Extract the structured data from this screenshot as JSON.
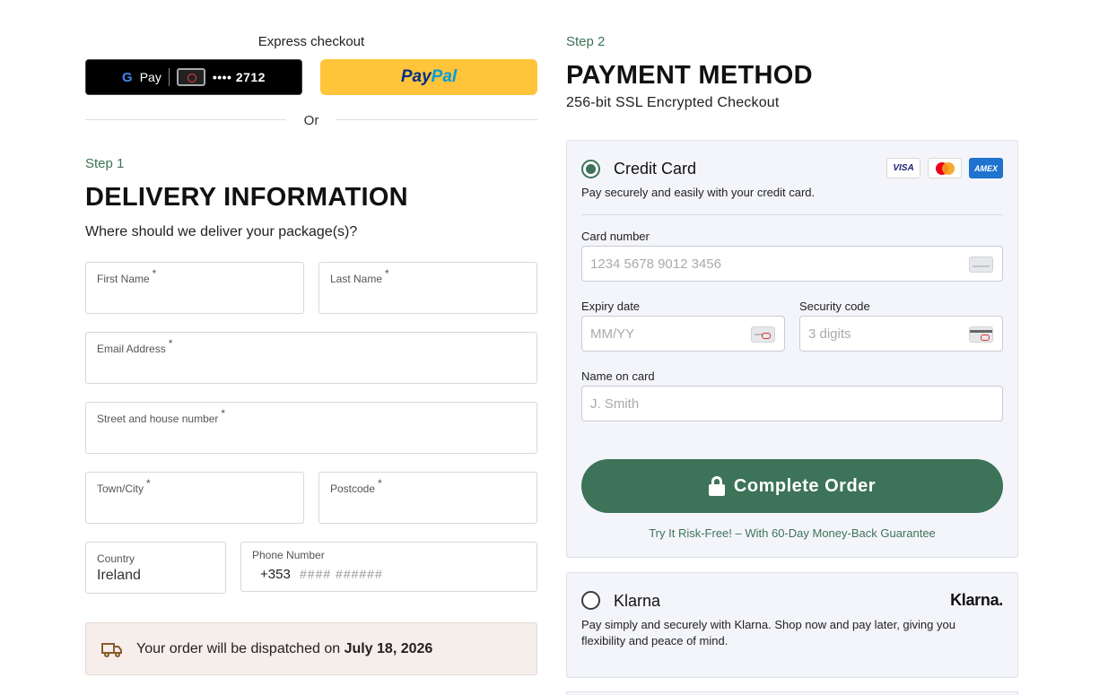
{
  "express": {
    "title": "Express checkout",
    "gpay_label": "Pay",
    "gpay_g": "G",
    "gpay_card": "•••• 2712",
    "paypal_1": "Pay",
    "paypal_2": "Pal",
    "or": "Or"
  },
  "delivery": {
    "step": "Step 1",
    "title": "DELIVERY INFORMATION",
    "subtitle": "Where should we deliver your package(s)?",
    "required_mark": "*",
    "fields": {
      "first_name": "First Name",
      "last_name": "Last Name",
      "email": "Email Address",
      "street": "Street and house number",
      "town": "Town/City",
      "postcode": "Postcode",
      "country_label": "Country",
      "country_value": "Ireland",
      "phone_label": "Phone Number",
      "phone_code": "+353",
      "phone_placeholder": "#### ######"
    },
    "dispatch_prefix": "Your order will be dispatched on",
    "dispatch_date": "July 18, 2026"
  },
  "payment": {
    "step": "Step 2",
    "title": "PAYMENT METHOD",
    "subtitle": "256-bit SSL Encrypted Checkout",
    "credit_card": {
      "title": "Credit Card",
      "selected": true,
      "description": "Pay securely and easily with your credit card.",
      "badges": [
        "VISA",
        "MC",
        "AMEX"
      ],
      "card_number_label": "Card number",
      "card_number_placeholder": "1234 5678 9012 3456",
      "expiry_label": "Expiry date",
      "expiry_placeholder": "MM/YY",
      "security_label": "Security code",
      "security_placeholder": "3 digits",
      "name_label": "Name on card",
      "name_placeholder": "J. Smith",
      "button": "Complete Order",
      "guarantee": "Try It Risk-Free! – With 60-Day Money-Back Guarantee"
    },
    "klarna": {
      "title": "Klarna",
      "selected": false,
      "logo": "Klarna.",
      "description_line1": "Pay simply and securely with Klarna. Shop now and pay later, giving you",
      "description_line2": "flexibility and peace of mind."
    }
  },
  "colors": {
    "accent_green": "#3d7358",
    "paypal_yellow": "#ffc439",
    "panel_bg": "#f4f5fa",
    "dispatch_bg": "#f5eeeb"
  }
}
